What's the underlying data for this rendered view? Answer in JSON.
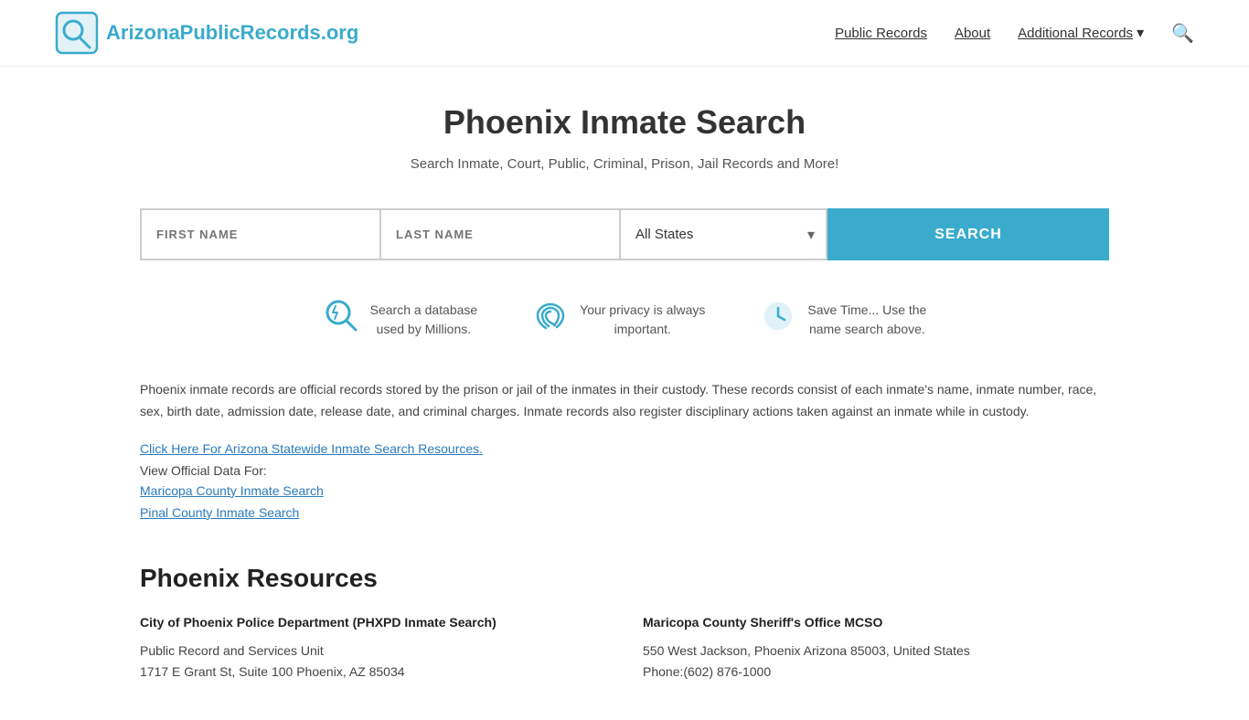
{
  "header": {
    "logo_text": "ArizonaPublicRecords.org",
    "logo_icon_label": "magnifying-glass-logo",
    "nav": {
      "public_records": "Public Records",
      "about": "About",
      "additional_records": "Additional Records",
      "additional_records_arrow": "▾"
    }
  },
  "main": {
    "title": "Phoenix Inmate Search",
    "subtitle": "Search Inmate, Court, Public, Criminal, Prison, Jail Records and More!",
    "search": {
      "first_name_placeholder": "FIRST NAME",
      "last_name_placeholder": "LAST NAME",
      "state_default": "All States",
      "search_button_label": "SEARCH"
    },
    "features": [
      {
        "icon": "🔍",
        "text": "Search a database\nused by Millions."
      },
      {
        "icon": "👆",
        "text": "Your privacy is always\nimportant."
      },
      {
        "icon": "🕐",
        "text": "Save Time... Use the\nname search above."
      }
    ],
    "body_text": "Phoenix inmate records are official records stored by the prison or jail of the inmates in their custody. These records consist of each inmate's name, inmate number, race, sex, birth date, admission date, release date, and criminal charges. Inmate records also register disciplinary actions taken against an inmate while in custody.",
    "statewide_link": "Click Here For Arizona Statewide Inmate Search Resources.",
    "view_official_label": "View Official Data For:",
    "county_links": [
      "Maricopa County Inmate Search",
      "Pinal County Inmate Search"
    ],
    "resources_title": "Phoenix Resources",
    "resources": [
      {
        "name": "City of Phoenix Police Department (PHXPD Inmate Search)",
        "line1": "Public Record and Services Unit",
        "line2": "1717 E Grant St, Suite 100 Phoenix, AZ 85034"
      },
      {
        "name": "Maricopa County Sheriff's Office MCSO",
        "line1": "550 West Jackson, Phoenix Arizona 85003, United States",
        "line2": "Phone:(602) 876-1000"
      }
    ]
  }
}
